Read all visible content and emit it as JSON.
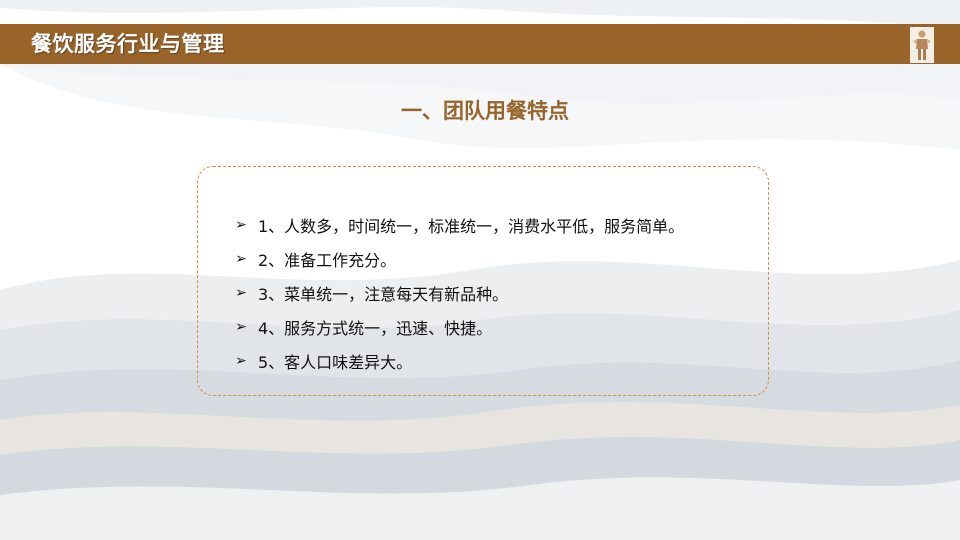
{
  "header": {
    "title": "餐饮服务行业与管理",
    "bar_color": "#98642a"
  },
  "section": {
    "title": "一、团队用餐特点",
    "title_color": "#98642a"
  },
  "content_box": {
    "border_color": "#d98a3e"
  },
  "points": {
    "bullet_icon": "arrow-right-icon",
    "items": [
      {
        "label": "1、人数多，时间统一，标准统一，消费水平低，服务简单。"
      },
      {
        "label": "2、准备工作充分。"
      },
      {
        "label": "3、菜单统一，注意每天有新品种。"
      },
      {
        "label": "4、服务方式统一，迅速、快捷。"
      },
      {
        "label": "5、客人口味差异大。"
      }
    ]
  }
}
